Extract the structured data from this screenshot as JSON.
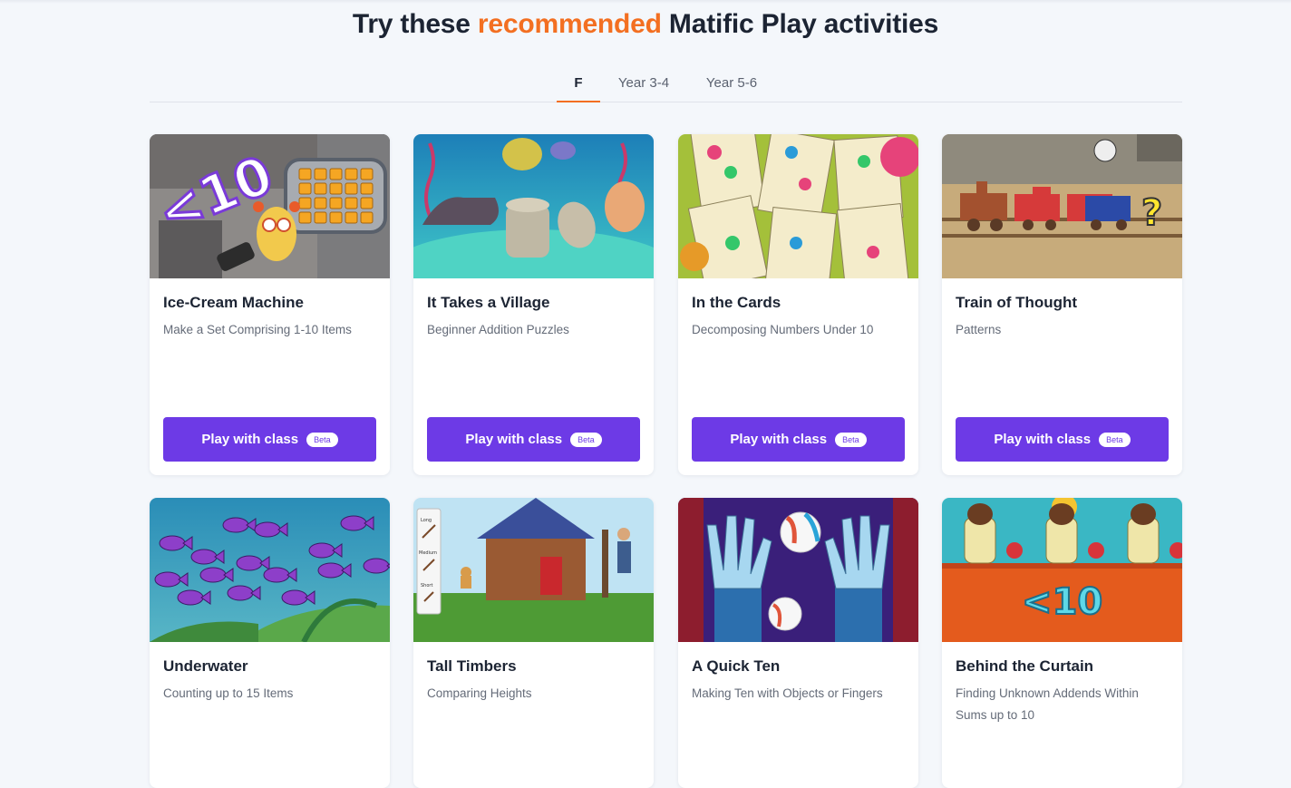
{
  "heading": {
    "prefix": "Try these ",
    "accent": "recommended",
    "suffix": " Matific Play activities",
    "accent_color": "#f36f21"
  },
  "tabs": [
    {
      "label": "F",
      "active": true
    },
    {
      "label": "Year 3-4",
      "active": false
    },
    {
      "label": "Year 5-6",
      "active": false
    }
  ],
  "button_color": "#6d3ae6",
  "cards": [
    {
      "title": "Ice-Cream Machine",
      "subtitle": "Make a Set Comprising 1-10 Items",
      "play_label": "Play with class",
      "badge": "Beta",
      "thumb_text": "<10"
    },
    {
      "title": "It Takes a Village",
      "subtitle": "Beginner Addition Puzzles",
      "play_label": "Play with class",
      "badge": "Beta"
    },
    {
      "title": "In the Cards",
      "subtitle": "Decomposing Numbers Under 10",
      "play_label": "Play with class",
      "badge": "Beta"
    },
    {
      "title": "Train of Thought",
      "subtitle": "Patterns",
      "play_label": "Play with class",
      "badge": "Beta",
      "thumb_text": "?"
    },
    {
      "title": "Underwater",
      "subtitle": "Counting up to 15 Items"
    },
    {
      "title": "Tall Timbers",
      "subtitle": "Comparing Heights",
      "thumb_labels": [
        "Long",
        "Medium",
        "Short"
      ]
    },
    {
      "title": "A Quick Ten",
      "subtitle": "Making Ten with Objects or Fingers"
    },
    {
      "title": "Behind the Curtain",
      "subtitle": "Finding Unknown Addends Within Sums up to 10",
      "thumb_text": "<10"
    }
  ]
}
